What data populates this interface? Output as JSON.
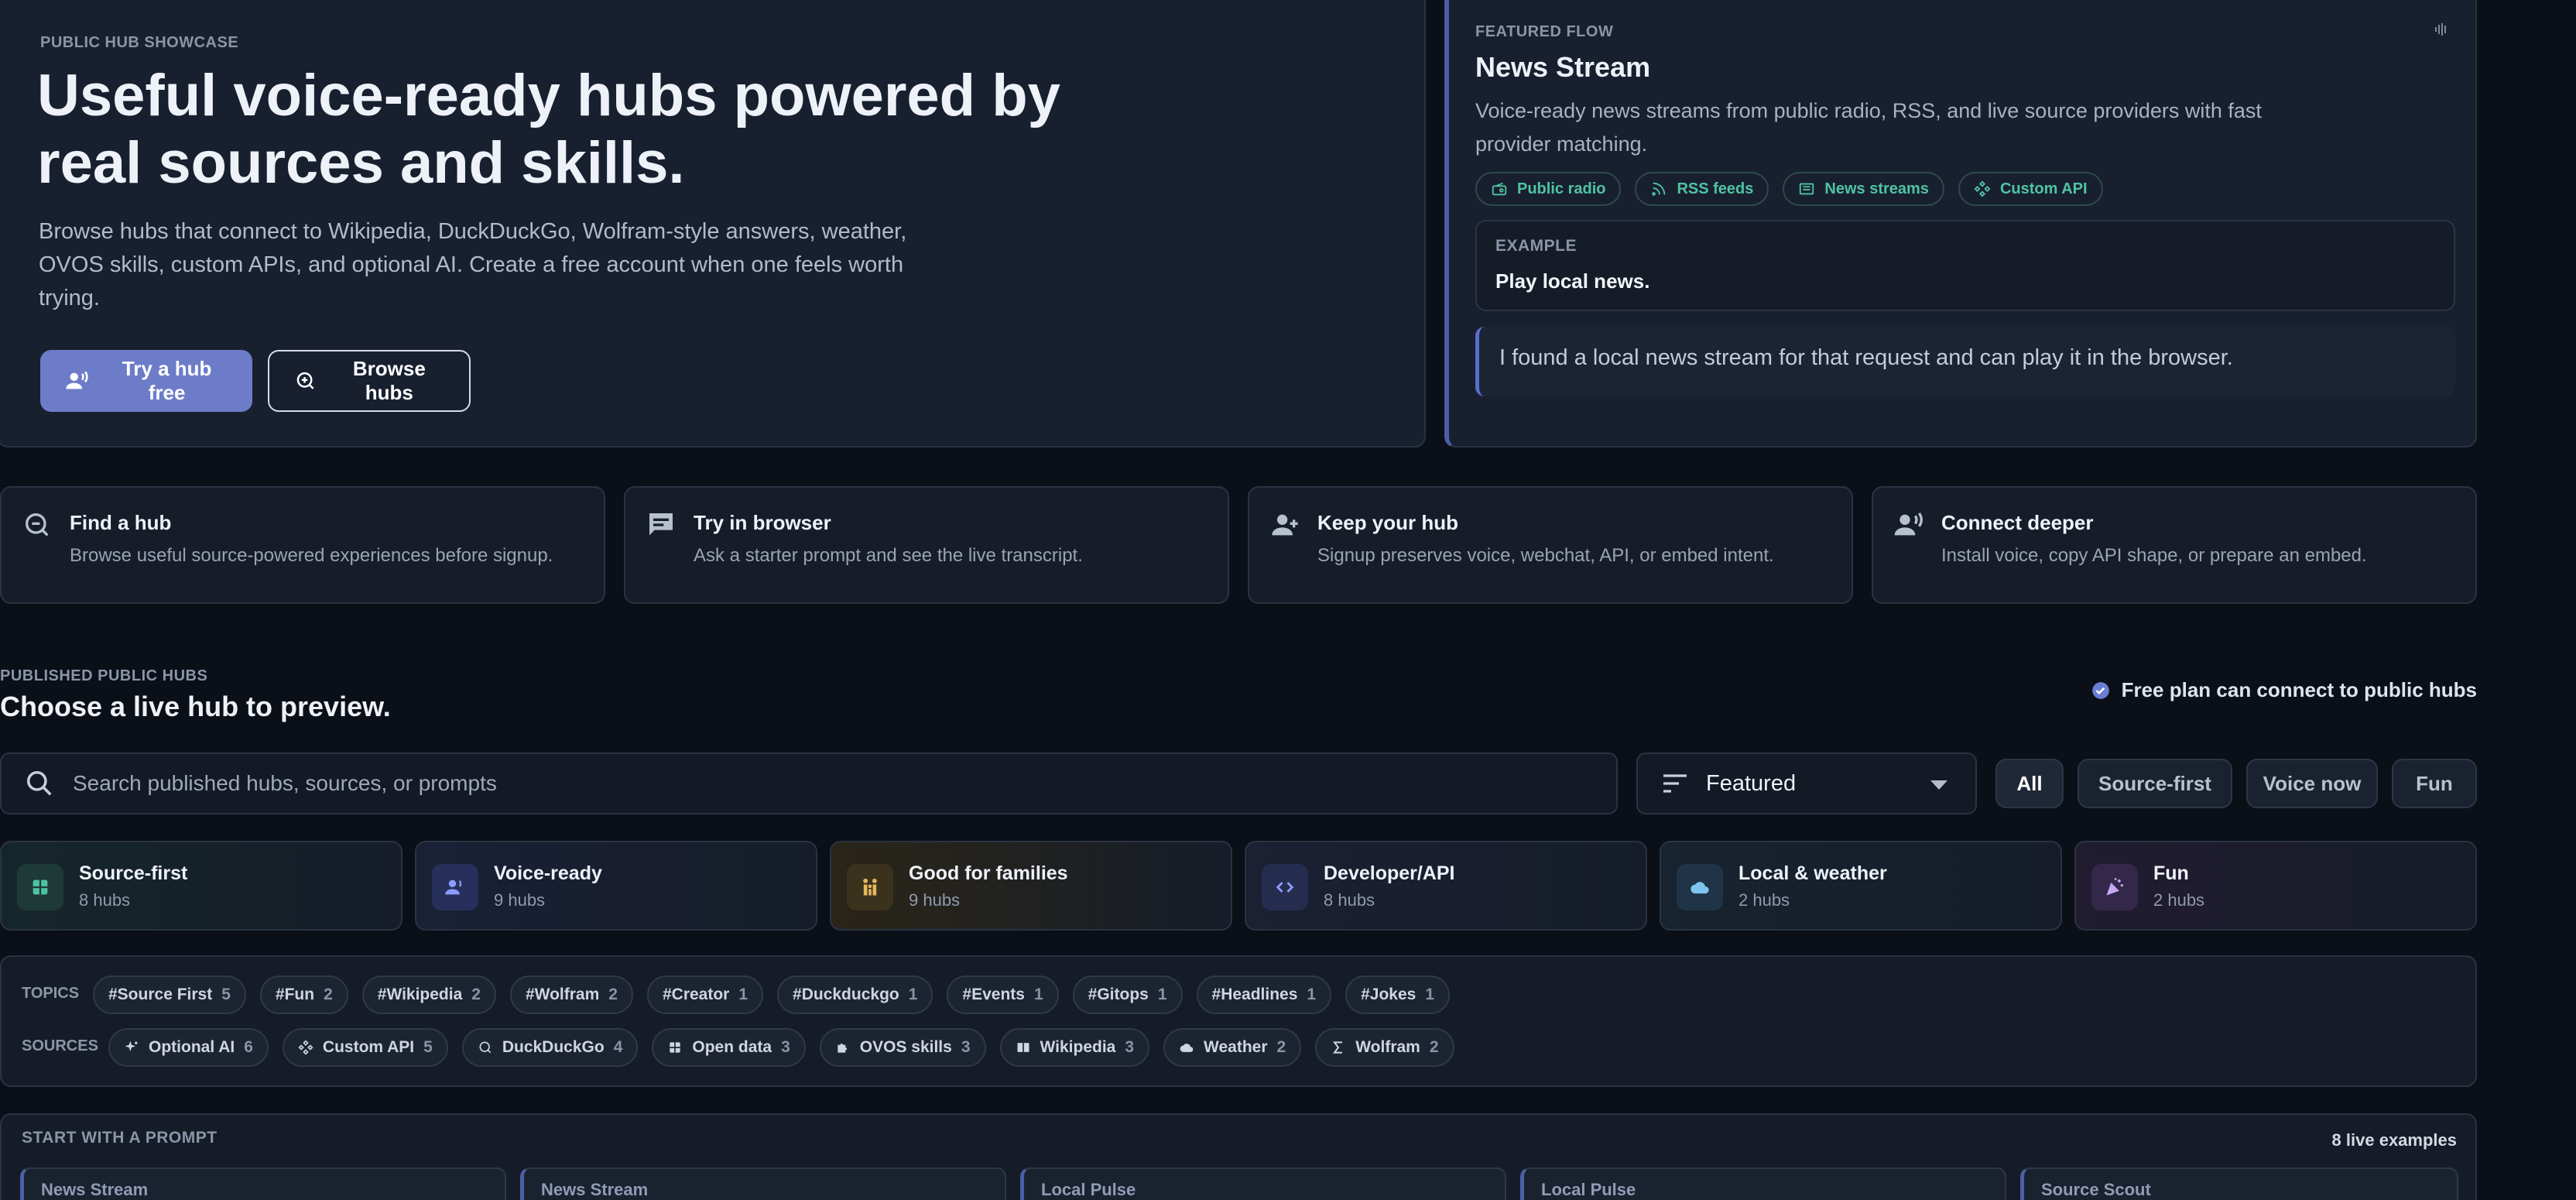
{
  "hero": {
    "overline": "PUBLIC HUB SHOWCASE",
    "title": "Useful voice-ready hubs powered by real sources and skills.",
    "description": "Browse hubs that connect to Wikipedia, DuckDuckGo, Wolfram-style answers, weather, OVOS skills, custom APIs, and optional AI. Create a free account when one feels worth trying.",
    "try_button": "Try a hub free",
    "browse_button": "Browse hubs"
  },
  "featured": {
    "overline": "FEATURED FLOW",
    "title": "News Stream",
    "description": "Voice-ready news streams from public radio, RSS, and live source providers with fast provider matching.",
    "chips": [
      "Public radio",
      "RSS feeds",
      "News streams",
      "Custom API"
    ],
    "example_label": "EXAMPLE",
    "example_prompt": "Play local news.",
    "reply": "I found a local news stream for that request and can play it in the browser."
  },
  "steps": [
    {
      "title": "Find a hub",
      "desc": "Browse useful source-powered experiences before signup."
    },
    {
      "title": "Try in browser",
      "desc": "Ask a starter prompt and see the live transcript."
    },
    {
      "title": "Keep your hub",
      "desc": "Signup preserves voice, webchat, API, or embed intent."
    },
    {
      "title": "Connect deeper",
      "desc": "Install voice, copy API shape, or prepare an embed."
    }
  ],
  "published": {
    "overline": "PUBLISHED PUBLIC HUBS",
    "title": "Choose a live hub to preview.",
    "free_plan": "Free plan can connect to public hubs",
    "search_placeholder": "Search published hubs, sources, or prompts",
    "sort_value": "Featured",
    "filters": [
      "All",
      "Source-first",
      "Voice now",
      "Fun"
    ]
  },
  "categories": [
    {
      "title": "Source-first",
      "count": "8 hubs"
    },
    {
      "title": "Voice-ready",
      "count": "9 hubs"
    },
    {
      "title": "Good for families",
      "count": "9 hubs"
    },
    {
      "title": "Developer/API",
      "count": "8 hubs"
    },
    {
      "title": "Local & weather",
      "count": "2 hubs"
    },
    {
      "title": "Fun",
      "count": "2 hubs"
    }
  ],
  "topics": {
    "label": "TOPICS",
    "items": [
      {
        "name": "#Source First",
        "n": "5"
      },
      {
        "name": "#Fun",
        "n": "2"
      },
      {
        "name": "#Wikipedia",
        "n": "2"
      },
      {
        "name": "#Wolfram",
        "n": "2"
      },
      {
        "name": "#Creator",
        "n": "1"
      },
      {
        "name": "#Duckduckgo",
        "n": "1"
      },
      {
        "name": "#Events",
        "n": "1"
      },
      {
        "name": "#Gitops",
        "n": "1"
      },
      {
        "name": "#Headlines",
        "n": "1"
      },
      {
        "name": "#Jokes",
        "n": "1"
      }
    ]
  },
  "sources": {
    "label": "SOURCES",
    "items": [
      {
        "name": "Optional AI",
        "n": "6",
        "icon": "sparkle-icon"
      },
      {
        "name": "Custom API",
        "n": "5",
        "icon": "api-icon"
      },
      {
        "name": "DuckDuckGo",
        "n": "4",
        "icon": "search-globe-icon"
      },
      {
        "name": "Open data",
        "n": "3",
        "icon": "grid-icon"
      },
      {
        "name": "OVOS skills",
        "n": "3",
        "icon": "puzzle-icon"
      },
      {
        "name": "Wikipedia",
        "n": "3",
        "icon": "book-icon"
      },
      {
        "name": "Weather",
        "n": "2",
        "icon": "cloud-icon"
      },
      {
        "name": "Wolfram",
        "n": "2",
        "icon": "sigma-icon"
      }
    ]
  },
  "prompts": {
    "overline": "START WITH A PROMPT",
    "live_count": "8 live examples",
    "cards": [
      "News Stream",
      "News Stream",
      "Local Pulse",
      "Local Pulse",
      "Source Scout"
    ]
  },
  "colors": {
    "accent": "#6c7cc8",
    "chip_green": "#4fc3a1",
    "background": "#0b0f17",
    "card": "#161d29"
  }
}
